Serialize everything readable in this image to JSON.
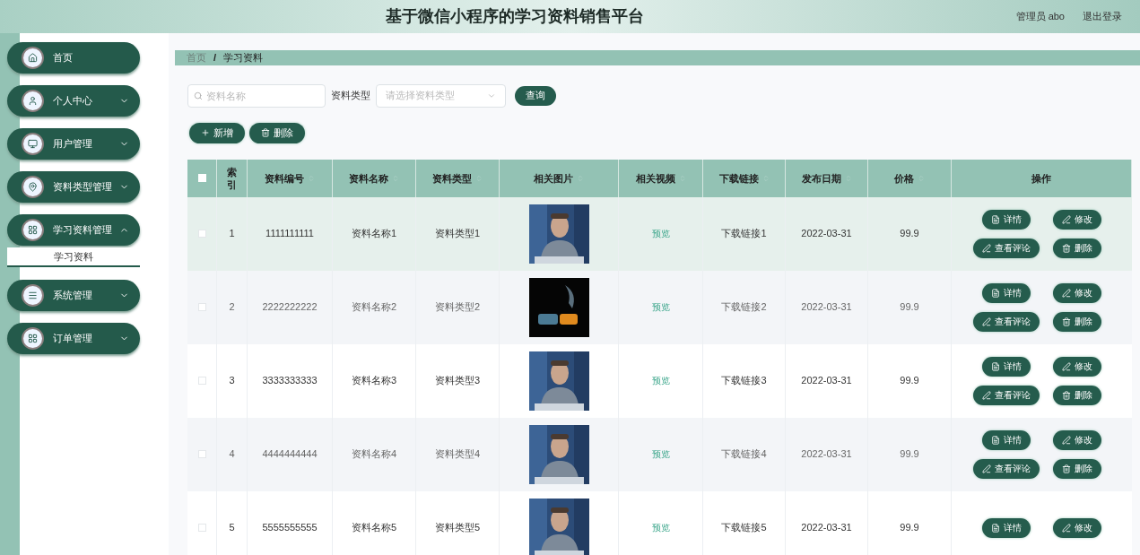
{
  "header": {
    "title": "基于微信小程序的学习资料销售平台",
    "user": "管理员 abo",
    "logout": "退出登录"
  },
  "sidebar": {
    "items": [
      {
        "label": "首页"
      },
      {
        "label": "个人中心",
        "expanded": false
      },
      {
        "label": "用户管理",
        "expanded": false
      },
      {
        "label": "资料类型管理",
        "expanded": false
      },
      {
        "label": "学习资料管理",
        "expanded": true,
        "children": [
          {
            "label": "学习资料",
            "selected": true
          }
        ]
      },
      {
        "label": "系统管理",
        "expanded": false
      },
      {
        "label": "订单管理",
        "expanded": false
      }
    ]
  },
  "breadcrumb": [
    "首页",
    "学习资料"
  ],
  "breadcrumb_separator": "/",
  "search": {
    "placeholder": "资料名称",
    "type_label": "资料类型",
    "type_placeholder": "请选择资料类型",
    "query_button": "查询"
  },
  "toolbar": [
    {
      "label": "新增",
      "kind": "add"
    },
    {
      "label": "删除",
      "kind": "delete"
    }
  ],
  "table": {
    "columns": [
      {
        "label": "索引",
        "sortable": false
      },
      {
        "label": "资料编号",
        "sortable": true
      },
      {
        "label": "资料名称",
        "sortable": true
      },
      {
        "label": "资料类型",
        "sortable": true
      },
      {
        "label": "相关图片",
        "sortable": true
      },
      {
        "label": "相关视频",
        "sortable": true
      },
      {
        "label": "下载链接",
        "sortable": true
      },
      {
        "label": "发布日期",
        "sortable": true
      },
      {
        "label": "价格",
        "sortable": true
      },
      {
        "label": "操作",
        "sortable": false
      }
    ],
    "header_checked": false,
    "rows": [
      {
        "checked": false,
        "hovered": true,
        "index": "1",
        "code": "1111111111",
        "name": "资料名称1",
        "type": "资料类型1",
        "video": "预览",
        "link": "下载链接1",
        "date": "2022-03-31",
        "price": "99.9",
        "actions": [
          {
            "label": "详情",
            "kind": "detail"
          },
          {
            "label": "修改",
            "kind": "edit"
          },
          {
            "label": "查看评论",
            "kind": "edit"
          },
          {
            "label": "删除",
            "kind": "delete"
          }
        ]
      },
      {
        "checked": false,
        "hovered": false,
        "index": "2",
        "code": "2222222222",
        "name": "资料名称2",
        "type": "资料类型2",
        "video": "预览",
        "link": "下载链接2",
        "date": "2022-03-31",
        "price": "99.9",
        "actions": [
          {
            "label": "详情",
            "kind": "detail"
          },
          {
            "label": "修改",
            "kind": "edit"
          },
          {
            "label": "查看评论",
            "kind": "edit"
          },
          {
            "label": "删除",
            "kind": "delete"
          }
        ]
      },
      {
        "checked": false,
        "hovered": false,
        "index": "3",
        "code": "3333333333",
        "name": "资料名称3",
        "type": "资料类型3",
        "video": "预览",
        "link": "下载链接3",
        "date": "2022-03-31",
        "price": "99.9",
        "actions": [
          {
            "label": "详情",
            "kind": "detail"
          },
          {
            "label": "修改",
            "kind": "edit"
          },
          {
            "label": "查看评论",
            "kind": "edit"
          },
          {
            "label": "删除",
            "kind": "delete"
          }
        ]
      },
      {
        "checked": false,
        "hovered": false,
        "index": "4",
        "code": "4444444444",
        "name": "资料名称4",
        "type": "资料类型4",
        "video": "预览",
        "link": "下载链接4",
        "date": "2022-03-31",
        "price": "99.9",
        "actions": [
          {
            "label": "详情",
            "kind": "detail"
          },
          {
            "label": "修改",
            "kind": "edit"
          },
          {
            "label": "查看评论",
            "kind": "edit"
          },
          {
            "label": "删除",
            "kind": "delete"
          }
        ]
      },
      {
        "checked": false,
        "hovered": false,
        "index": "5",
        "code": "5555555555",
        "name": "资料名称5",
        "type": "资料类型5",
        "video": "预览",
        "link": "下载链接5",
        "date": "2022-03-31",
        "price": "99.9",
        "actions": [
          {
            "label": "详情",
            "kind": "detail"
          },
          {
            "label": "修改",
            "kind": "edit"
          }
        ]
      }
    ]
  }
}
